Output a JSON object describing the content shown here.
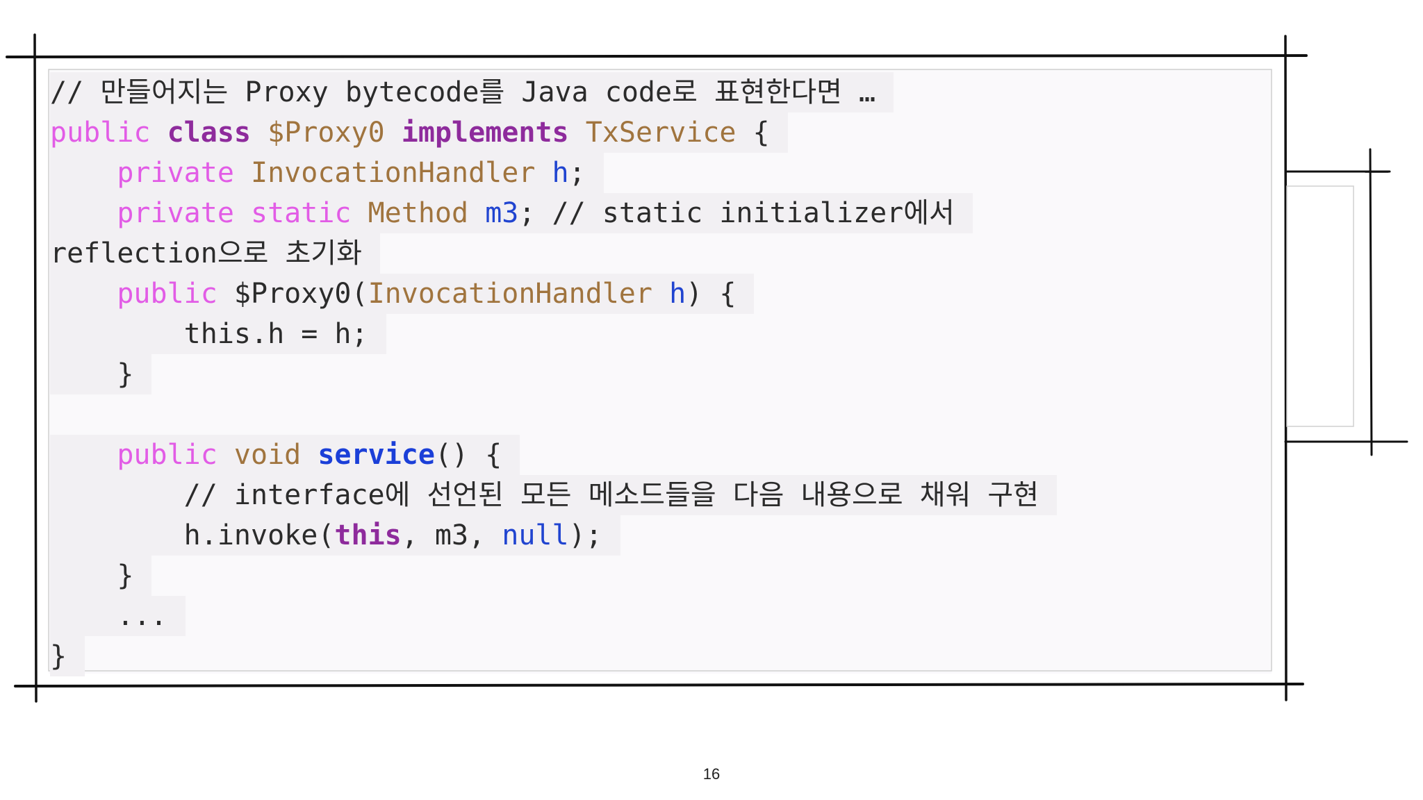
{
  "code": {
    "l1": [
      "// 만들어지는 Proxy bytecode를 Java code로 표현한다면 …"
    ],
    "l2": [
      "public",
      " ",
      "class",
      " ",
      "$Proxy0",
      " ",
      "implements",
      " ",
      "TxService",
      " {"
    ],
    "l3": [
      "    ",
      "private",
      " ",
      "InvocationHandler",
      " ",
      "h",
      ";"
    ],
    "l4": [
      "    ",
      "private",
      " ",
      "static",
      " ",
      "Method",
      " ",
      "m3",
      "; // static initializer에서"
    ],
    "l5": [
      "reflection으로 초기화"
    ],
    "l6": [
      "    ",
      "public",
      " $Proxy0(",
      "InvocationHandler",
      " ",
      "h",
      ") {"
    ],
    "l7": [
      "        this.h = h;"
    ],
    "l8": [
      "    }"
    ],
    "l10": [
      "    ",
      "public",
      " ",
      "void",
      " ",
      "service",
      "() {"
    ],
    "l11": [
      "        // interface에 선언된 모든 메소드들을 다음 내용으로 채워 구현"
    ],
    "l12": [
      "        h.invoke(",
      "this",
      ", m3, ",
      "null",
      ");"
    ],
    "l13": [
      "    }"
    ],
    "l14": [
      "    ..."
    ],
    "l15": [
      "}"
    ]
  },
  "page_number": "16"
}
